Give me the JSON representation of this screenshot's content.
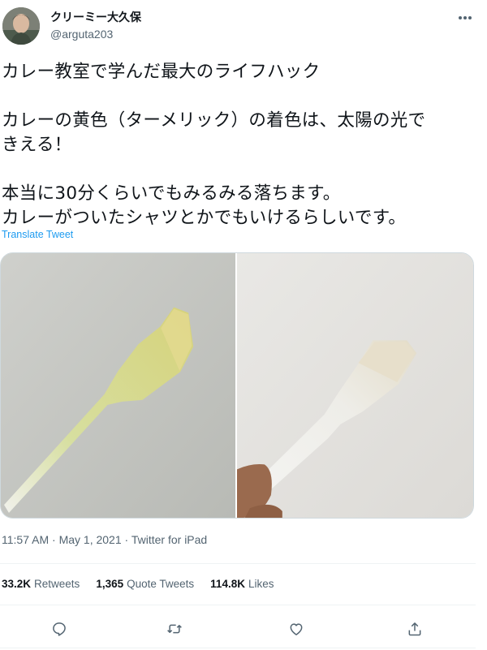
{
  "user": {
    "display_name": "クリーミー大久保",
    "handle": "@arguta203"
  },
  "tweet": {
    "lines": [
      "カレー教室で学んだ最大のライフハック",
      "カレーの黄色（ターメリック）の着色は、太陽の光で",
      "きえる！",
      "本当に30分くらいでもみるみる落ちます。",
      "カレーがついたシャツとかでもいけるらしいです。"
    ],
    "translate_label": "Translate Tweet"
  },
  "meta": {
    "time": "11:57 AM",
    "separator": " · ",
    "date": "May 1, 2021",
    "source": "Twitter for iPad"
  },
  "stats": {
    "retweets_count": "33.2K",
    "retweets_label": "Retweets",
    "quotes_count": "1,365",
    "quotes_label": "Quote Tweets",
    "likes_count": "114.8K",
    "likes_label": "Likes"
  },
  "icons": {
    "more": "more-icon",
    "reply": "reply-icon",
    "retweet": "retweet-icon",
    "like": "heart-icon",
    "share": "share-icon"
  },
  "colors": {
    "link": "#1d9bf0",
    "secondary_text": "#536471",
    "primary_text": "#0f1419",
    "divider": "#eff3f4"
  }
}
